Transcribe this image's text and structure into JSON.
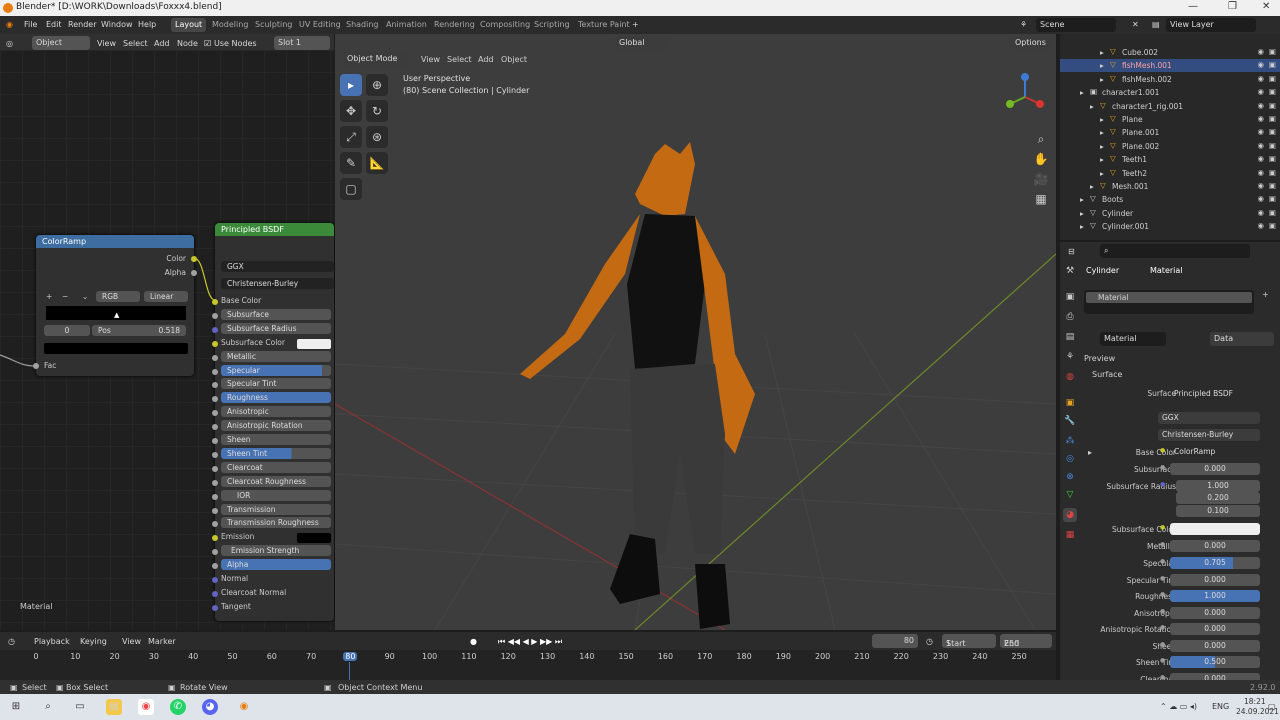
{
  "window": {
    "title": "Blender* [D:\\WORK\\Downloads\\Foxxx4.blend]"
  },
  "menu": [
    "File",
    "Edit",
    "Render",
    "Window",
    "Help"
  ],
  "workspaces": [
    "Layout",
    "Modeling",
    "Sculpting",
    "UV Editing",
    "Shading",
    "Animation",
    "Rendering",
    "Compositing",
    "Scripting",
    "Texture Paint"
  ],
  "scene": {
    "name": "Scene",
    "view_layer": "View Layer"
  },
  "node_header": {
    "mode": "Object",
    "items": [
      "View",
      "Select",
      "Add",
      "Node"
    ],
    "use_nodes": "Use Nodes",
    "slot": "Slot 1"
  },
  "colorramp": {
    "title": "ColorRamp",
    "out_color": "Color",
    "out_alpha": "Alpha",
    "mode": "RGB",
    "interp": "Linear",
    "index": "0",
    "pos_label": "Pos",
    "pos_value": "0.518",
    "fac": "Fac"
  },
  "bsdf": {
    "title": "Principled BSDF",
    "dist": "GGX",
    "sss": "Christensen-Burley",
    "inputs": [
      "Base Color",
      "Subsurface",
      "Subsurface Radius",
      "Subsurface Color",
      "Metallic",
      "Specular",
      "Specular Tint",
      "Roughness",
      "Anisotropic",
      "Anisotropic Rotation",
      "Sheen",
      "Sheen Tint",
      "Clearcoat",
      "Clearcoat Roughness",
      "IOR",
      "Transmission",
      "Transmission Roughness",
      "Emission",
      "Emission Strength",
      "Alpha",
      "Normal",
      "Clearcoat Normal",
      "Tangent"
    ]
  },
  "node_footer": "Material",
  "viewport": {
    "mode": "Object Mode",
    "items": [
      "View",
      "Select",
      "Add",
      "Object"
    ],
    "orientation": "Global",
    "options": "Options",
    "info_line1": "User Perspective",
    "info_line2": "(80) Scene Collection | Cylinder"
  },
  "outliner": {
    "rows": [
      {
        "name": "Cube.002",
        "indent": 3,
        "sel": false
      },
      {
        "name": "fishMesh.001",
        "indent": 3,
        "sel": true
      },
      {
        "name": "fishMesh.002",
        "indent": 3,
        "sel": false
      },
      {
        "name": "character1.001",
        "indent": 1,
        "sel": false
      },
      {
        "name": "character1_rig.001",
        "indent": 2,
        "sel": false
      },
      {
        "name": "Plane",
        "indent": 3,
        "sel": false
      },
      {
        "name": "Plane.001",
        "indent": 3,
        "sel": false
      },
      {
        "name": "Plane.002",
        "indent": 3,
        "sel": false
      },
      {
        "name": "Teeth1",
        "indent": 3,
        "sel": false
      },
      {
        "name": "Teeth2",
        "indent": 3,
        "sel": false
      },
      {
        "name": "Mesh.001",
        "indent": 2,
        "sel": false
      },
      {
        "name": "Boots",
        "indent": 1,
        "sel": false
      },
      {
        "name": "Cylinder",
        "indent": 1,
        "sel": false
      },
      {
        "name": "Cylinder.001",
        "indent": 1,
        "sel": false
      }
    ]
  },
  "properties": {
    "object": "Cylinder",
    "tab": "Material",
    "slot": "Material",
    "mat_name": "Material",
    "link": "Data",
    "preview": "Preview",
    "surface_panel": "Surface",
    "surface_label": "Surface",
    "surface_value": "Principled BSDF",
    "dist": "GGX",
    "sss": "Christensen-Burley",
    "rows": [
      {
        "label": "Base Color",
        "value": "ColorRamp"
      },
      {
        "label": "Subsurface",
        "value": "0.000"
      },
      {
        "label": "Subsurface Radius",
        "value": "1.000"
      },
      {
        "label": "",
        "value": "0.200"
      },
      {
        "label": "",
        "value": "0.100"
      },
      {
        "label": "Subsurface Color",
        "value": ""
      },
      {
        "label": "Metallic",
        "value": "0.000"
      },
      {
        "label": "Specular",
        "value": "0.705"
      },
      {
        "label": "Specular Tint",
        "value": "0.000"
      },
      {
        "label": "Roughness",
        "value": "1.000"
      },
      {
        "label": "Anisotropic",
        "value": "0.000"
      },
      {
        "label": "Anisotropic Rotation",
        "value": "0.000"
      },
      {
        "label": "Sheen",
        "value": "0.000"
      },
      {
        "label": "Sheen Tint",
        "value": "0.500"
      },
      {
        "label": "Clearcoat",
        "value": "0.000"
      }
    ]
  },
  "timeline": {
    "items": [
      "Playback",
      "Keying",
      "View",
      "Marker"
    ],
    "current": "80",
    "start_label": "Start",
    "start": "1",
    "end_label": "End",
    "end": "250",
    "ticks": [
      "0",
      "10",
      "20",
      "30",
      "40",
      "50",
      "60",
      "70",
      "80",
      "90",
      "100",
      "110",
      "120",
      "130",
      "140",
      "150",
      "160",
      "170",
      "180",
      "190",
      "200",
      "210",
      "220",
      "230",
      "240",
      "250"
    ]
  },
  "status": {
    "select": "Select",
    "box": "Box Select",
    "rotate": "Rotate View",
    "ctx": "Object Context Menu",
    "version": "2.92.0"
  },
  "taskbar": {
    "lang": "ENG",
    "time": "18:21",
    "date": "24.09.2021"
  }
}
